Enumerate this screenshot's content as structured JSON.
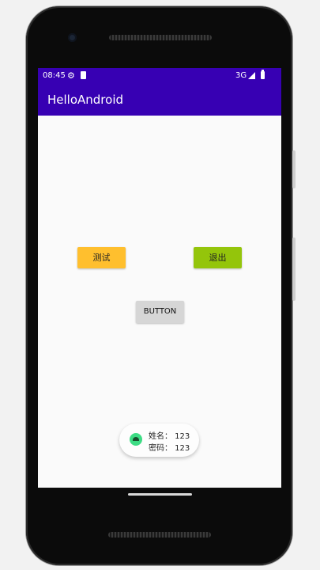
{
  "status_bar": {
    "time": "08:45",
    "network": "3G",
    "icons": [
      "gear-icon",
      "sdcard-icon",
      "signal-icon",
      "battery-icon"
    ]
  },
  "app_bar": {
    "title": "HelloAndroid"
  },
  "buttons": {
    "test_label": "测试",
    "exit_label": "退出",
    "button_label": "BUTTON"
  },
  "toast": {
    "icon": "android-icon",
    "line1": "姓名： 123",
    "line2": "密码： 123"
  },
  "colors": {
    "primary": "#3700b3",
    "test_button": "#ffbf2e",
    "exit_button": "#94c50b",
    "default_button": "#d6d6d6"
  }
}
